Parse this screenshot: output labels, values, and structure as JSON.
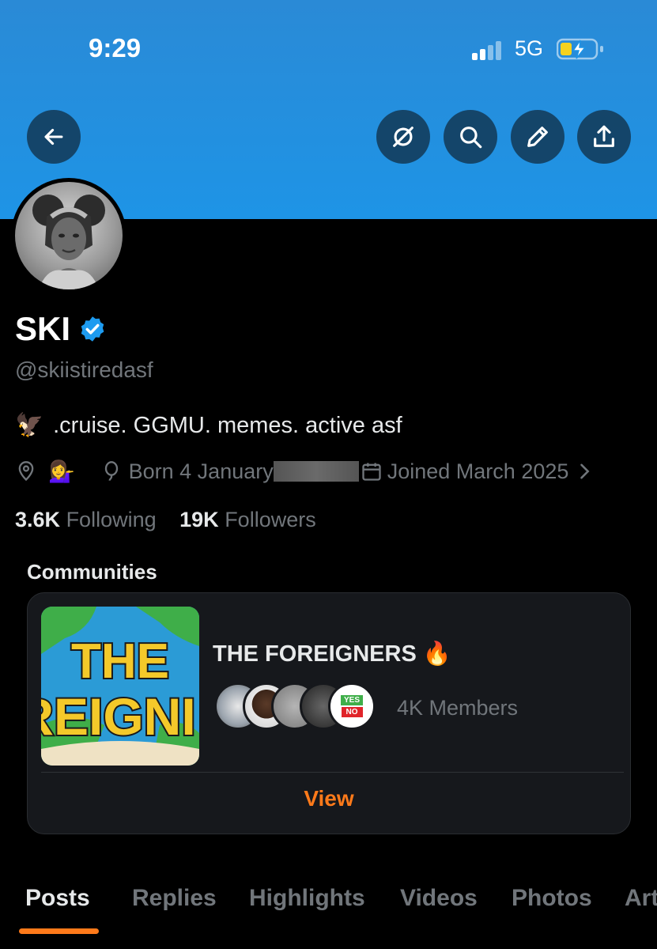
{
  "status_bar": {
    "time": "9:29",
    "network": "5G"
  },
  "header": {
    "icons": [
      "back-arrow-icon",
      "grok-icon",
      "search-icon",
      "edit-icon",
      "share-icon"
    ]
  },
  "profile": {
    "name": "SKI",
    "handle": "@skiistiredasf",
    "bio": ".cruise. GGMU. memes. active asf",
    "bio_emoji": "🦅",
    "location_emoji": "💁‍♀️",
    "born": "Born 4 January",
    "joined": "Joined March 2025",
    "following_count": "3.6K",
    "following_label": "Following",
    "followers_count": "19K",
    "followers_label": "Followers"
  },
  "communities": {
    "title": "Communities",
    "card": {
      "name": "THE FOREIGNERS",
      "name_emoji": "🔥",
      "image_text_1": "THE",
      "image_text_2": "REIGNI",
      "badge_yes": "YES",
      "badge_no": "NO",
      "members": "4K Members",
      "view_label": "View"
    }
  },
  "tabs": [
    {
      "label": "Posts",
      "active": true
    },
    {
      "label": "Replies",
      "active": false
    },
    {
      "label": "Highlights",
      "active": false
    },
    {
      "label": "Videos",
      "active": false
    },
    {
      "label": "Photos",
      "active": false
    },
    {
      "label": "Art",
      "active": false
    }
  ],
  "colors": {
    "banner": "#1e94e6",
    "accent": "#ff7a1a",
    "verified": "#1d9bf0",
    "muted": "#71767b"
  }
}
